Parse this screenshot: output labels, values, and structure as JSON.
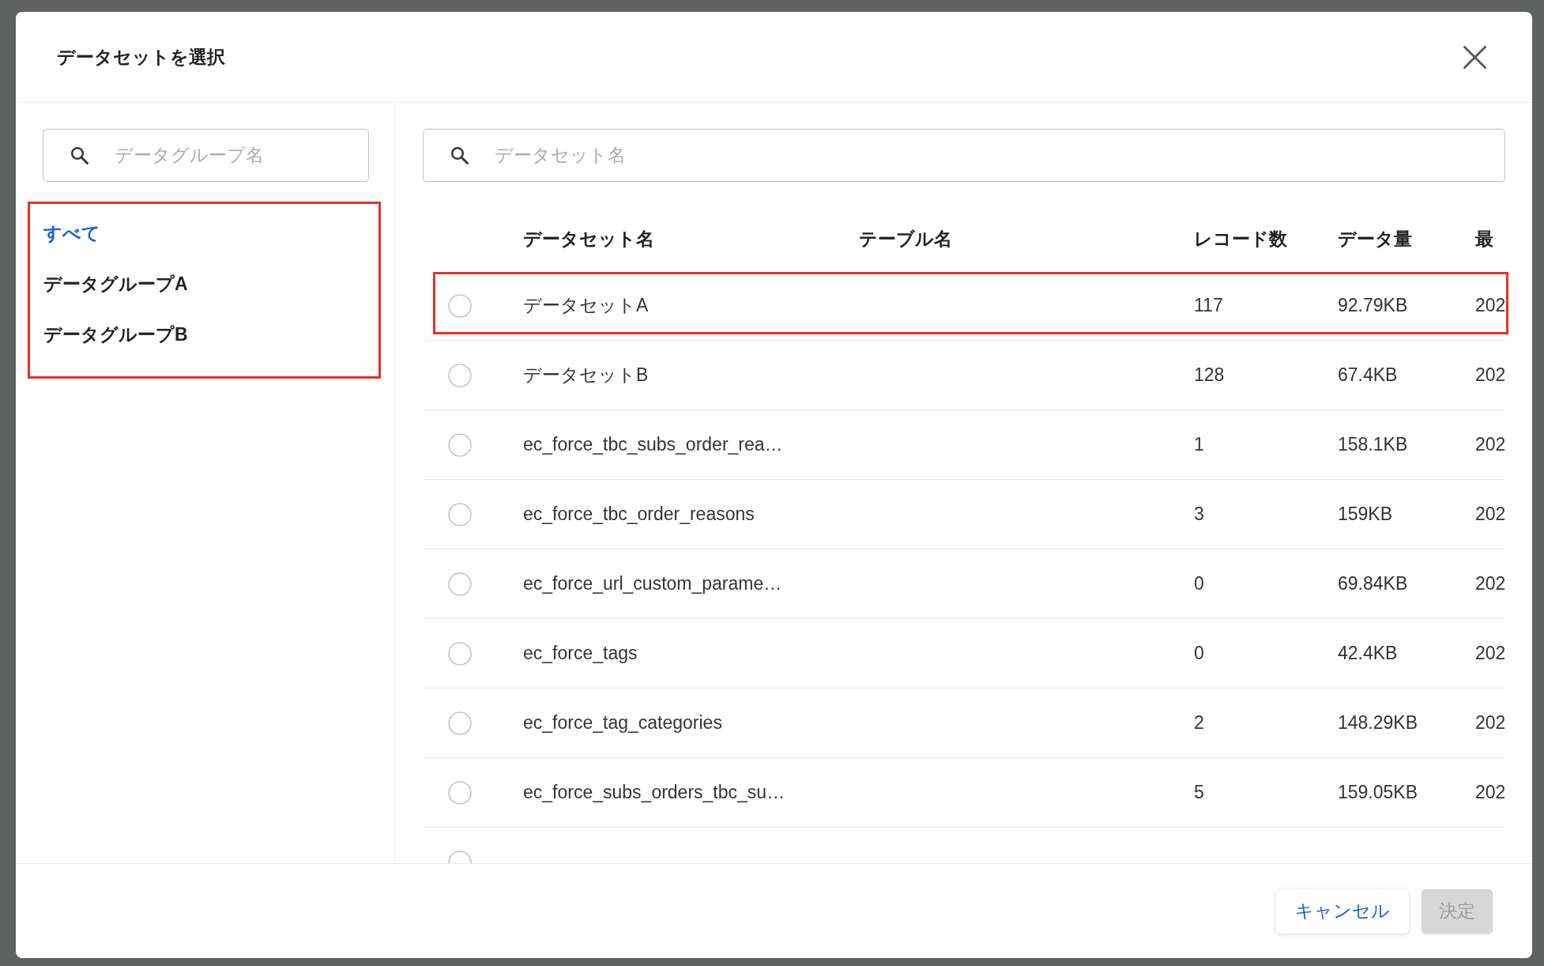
{
  "dialog": {
    "title": "データセットを選択"
  },
  "group_panel": {
    "search": {
      "placeholder": "データグループ名"
    },
    "highlighted": true,
    "groups": [
      {
        "label": "すべて",
        "selected": true
      },
      {
        "label": "データグループA",
        "selected": false
      },
      {
        "label": "データグループB",
        "selected": false
      }
    ]
  },
  "dataset_panel": {
    "search": {
      "placeholder": "データセット名"
    },
    "table": {
      "columns": [
        "データセット名",
        "テーブル名",
        "レコード数",
        "データ量",
        "最"
      ],
      "rows": [
        {
          "selected": false,
          "highlighted": true,
          "dataset_name": "データセットA",
          "record_count": "117",
          "data_size": "92.79KB",
          "column_5": "202"
        },
        {
          "selected": false,
          "highlighted": false,
          "dataset_name": "データセットB",
          "record_count": "128",
          "data_size": "67.4KB",
          "column_5": "202"
        },
        {
          "selected": false,
          "highlighted": false,
          "dataset_name": "ec_force_tbc_subs_order_rea…",
          "record_count": "1",
          "data_size": "158.1KB",
          "column_5": "202"
        },
        {
          "selected": false,
          "highlighted": false,
          "dataset_name": "ec_force_tbc_order_reasons",
          "record_count": "3",
          "data_size": "159KB",
          "column_5": "202"
        },
        {
          "selected": false,
          "highlighted": false,
          "dataset_name": "ec_force_url_custom_parame…",
          "record_count": "0",
          "data_size": "69.84KB",
          "column_5": "202"
        },
        {
          "selected": false,
          "highlighted": false,
          "dataset_name": "ec_force_tags",
          "record_count": "0",
          "data_size": "42.4KB",
          "column_5": "202"
        },
        {
          "selected": false,
          "highlighted": false,
          "dataset_name": "ec_force_tag_categories",
          "record_count": "2",
          "data_size": "148.29KB",
          "column_5": "202"
        },
        {
          "selected": false,
          "highlighted": false,
          "dataset_name": "ec_force_subs_orders_tbc_su…",
          "record_count": "5",
          "data_size": "159.05KB",
          "column_5": "202"
        },
        {
          "selected": false,
          "highlighted": false
        }
      ]
    }
  },
  "footer": {
    "buttons": [
      {
        "label": "キャンセル",
        "kind": "secondary",
        "disabled": false
      },
      {
        "label": "決定",
        "kind": "primary",
        "disabled": true
      }
    ]
  }
}
